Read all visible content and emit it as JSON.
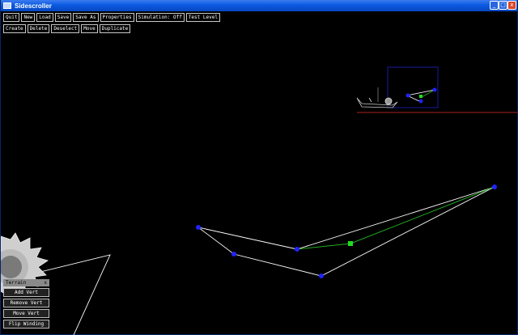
{
  "window": {
    "title": "Sidescroller",
    "minimize_glyph": "_",
    "maximize_glyph": "□",
    "close_glyph": "x"
  },
  "toolbar": {
    "row1": [
      "Quit",
      "New",
      "Load",
      "Save",
      "Save As",
      "Properties",
      "Simulation: Off",
      "Test Level"
    ],
    "row2": [
      "Create",
      "Delete",
      "Deselect",
      "Move",
      "Duplicate"
    ]
  },
  "terrain_panel": {
    "title": "Terrain",
    "close_glyph": "x",
    "buttons": [
      "Add Vert",
      "Remove Vert",
      "Move Vert",
      "Flip Winding"
    ]
  },
  "colors": {
    "background": "#000000",
    "terrain_line": "#ffffff",
    "selected_line": "#22aa22",
    "vertex": "#2222ff",
    "midpoint": "#22dd22",
    "ground_line": "#aa2222",
    "selection_box": "#1a1aa0"
  }
}
